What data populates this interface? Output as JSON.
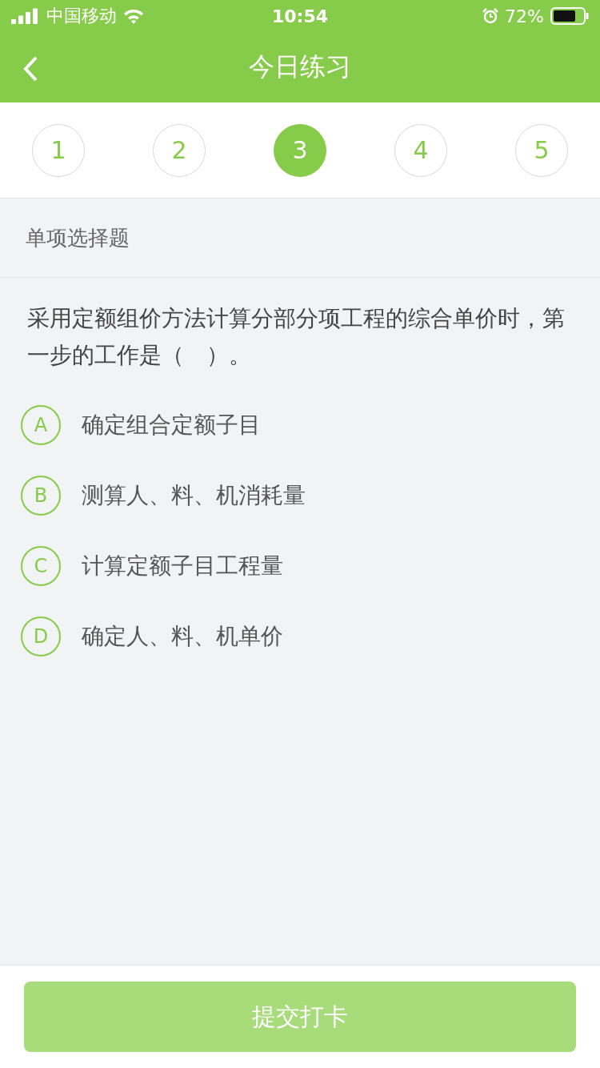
{
  "status_bar": {
    "carrier": "中国移动",
    "time": "10:54",
    "battery": "72%"
  },
  "nav": {
    "title": "今日练习"
  },
  "steps": [
    {
      "label": "1",
      "selected": false
    },
    {
      "label": "2",
      "selected": false
    },
    {
      "label": "3",
      "selected": true
    },
    {
      "label": "4",
      "selected": false
    },
    {
      "label": "5",
      "selected": false
    }
  ],
  "section": {
    "title": "单项选择题"
  },
  "question": {
    "text": "采用定额组价方法计算分部分项工程的综合单价时，第一步的工作是（　）。"
  },
  "options": [
    {
      "letter": "A",
      "text": "确定组合定额子目"
    },
    {
      "letter": "B",
      "text": "测算人、料、机消耗量"
    },
    {
      "letter": "C",
      "text": "计算定额子目工程量"
    },
    {
      "letter": "D",
      "text": "确定人、料、机单价"
    }
  ],
  "submit": {
    "label": "提交打卡",
    "disabled": true
  }
}
